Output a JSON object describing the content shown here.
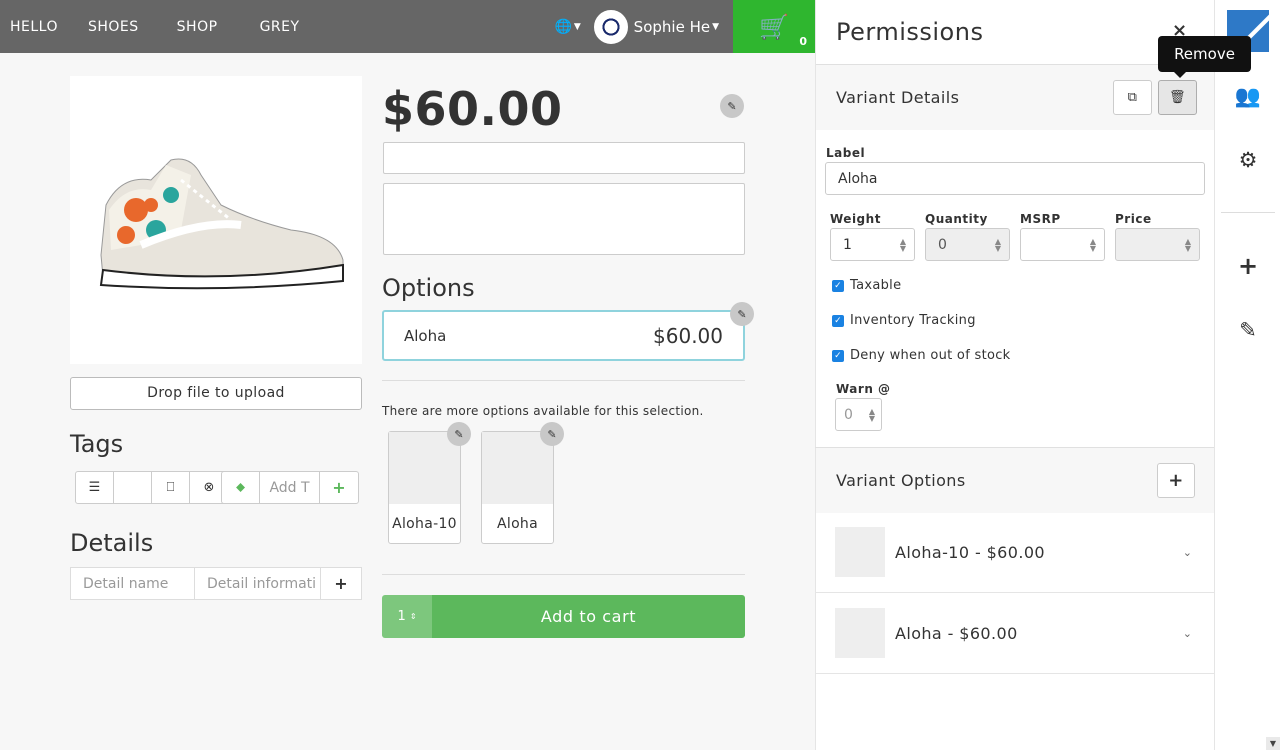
{
  "nav": {
    "items": [
      "HELLO",
      "SHOES",
      "SHOP",
      "GREY"
    ],
    "language_icon": "translate-icon",
    "user_name": "Sophie He",
    "cart_count": "0",
    "cart_icon": "cart-icon"
  },
  "product": {
    "price": "$60.00",
    "drop_label": "Drop file to upload",
    "tags_heading": "Tags",
    "tag_input_placeholder": "Add T",
    "details_heading": "Details",
    "detail_name_placeholder": "Detail name",
    "detail_info_placeholder": "Detail informati",
    "options_heading": "Options",
    "selected_option": {
      "name": "Aloha",
      "price": "$60.00"
    },
    "more_options_text": "There are more options available for this selection.",
    "thumbs": [
      "Aloha-10",
      "Aloha"
    ],
    "quantity": "1",
    "add_to_cart": "Add to cart"
  },
  "panel": {
    "title": "Permissions",
    "close_glyph": "×",
    "tooltip": "Remove",
    "variant_details_heading": "Variant Details",
    "label_label": "Label",
    "label_value": "Aloha",
    "weight_label": "Weight",
    "weight_value": "1",
    "quantity_label": "Quantity",
    "quantity_value": "0",
    "msrp_label": "MSRP",
    "msrp_value": "",
    "price_label": "Price",
    "price_value": "",
    "checks": [
      "Taxable",
      "Inventory Tracking",
      "Deny when out of stock"
    ],
    "warn_label": "Warn @",
    "warn_value": "0",
    "variant_options_heading": "Variant Options",
    "variants": [
      "Aloha-10 - $60.00",
      "Aloha - $60.00"
    ]
  },
  "colors": {
    "navbar": "#666666",
    "cart_green": "#2fb62f",
    "add_to_cart_green": "#5cb85c",
    "option_border": "#8fd3dd",
    "checkbox_blue": "#1a82e2",
    "logo_blue": "#2e79c7"
  }
}
